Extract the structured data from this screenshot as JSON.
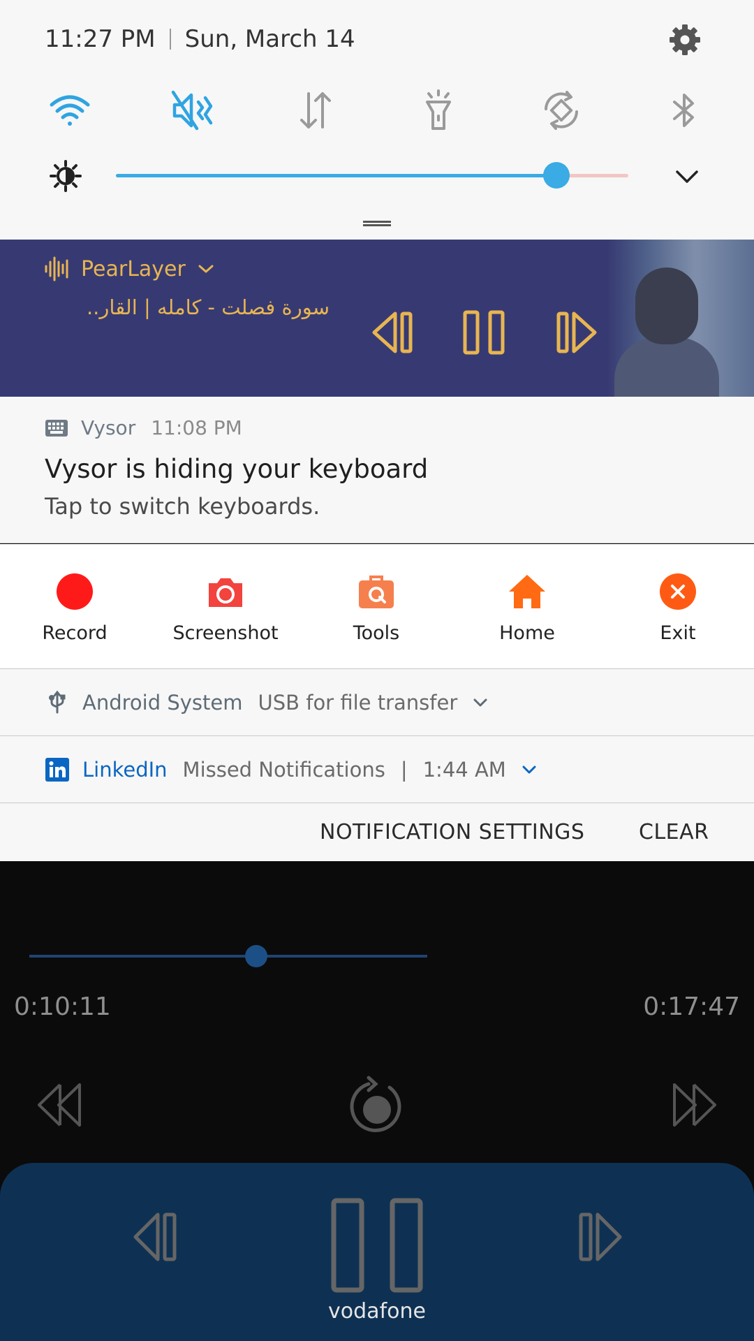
{
  "status": {
    "time": "11:27 PM",
    "date": "Sun, March 14"
  },
  "quick_tiles": [
    {
      "name": "wifi",
      "state": "on"
    },
    {
      "name": "sound",
      "state": "mute"
    },
    {
      "name": "mobile-data",
      "state": "off"
    },
    {
      "name": "flashlight",
      "state": "off"
    },
    {
      "name": "auto-rotate",
      "state": "off"
    },
    {
      "name": "bluetooth",
      "state": "off"
    }
  ],
  "brightness": {
    "level": 0.86
  },
  "media": {
    "app": "PearLayer",
    "track": "سورة فصلت - كامله | القار..",
    "accent": "#e8b552",
    "background": "#373a72"
  },
  "vysor": {
    "app": "Vysor",
    "time": "11:08 PM",
    "title": "Vysor is hiding your keyboard",
    "text": "Tap to switch keyboards."
  },
  "shortcuts": [
    {
      "label": "Record",
      "icon": "record-dot",
      "color": "#ff1a1a"
    },
    {
      "label": "Screenshot",
      "icon": "camera",
      "color": "#f2433e"
    },
    {
      "label": "Tools",
      "icon": "toolbox",
      "color": "#f5804e"
    },
    {
      "label": "Home",
      "icon": "house",
      "color": "#ff6a12"
    },
    {
      "label": "Exit",
      "icon": "close-circle",
      "color": "#ff5a14"
    }
  ],
  "android_system": {
    "app": "Android System",
    "text": "USB for file transfer"
  },
  "linkedin": {
    "app": "LinkedIn",
    "text": "Missed Notifications",
    "divider": "|",
    "time": "1:44 AM"
  },
  "footer": {
    "settings": "NOTIFICATION SETTINGS",
    "clear": "CLEAR"
  },
  "player": {
    "elapsed": "0:10:11",
    "total": "0:17:47",
    "progress": 0.57,
    "carrier": "vodafone"
  }
}
